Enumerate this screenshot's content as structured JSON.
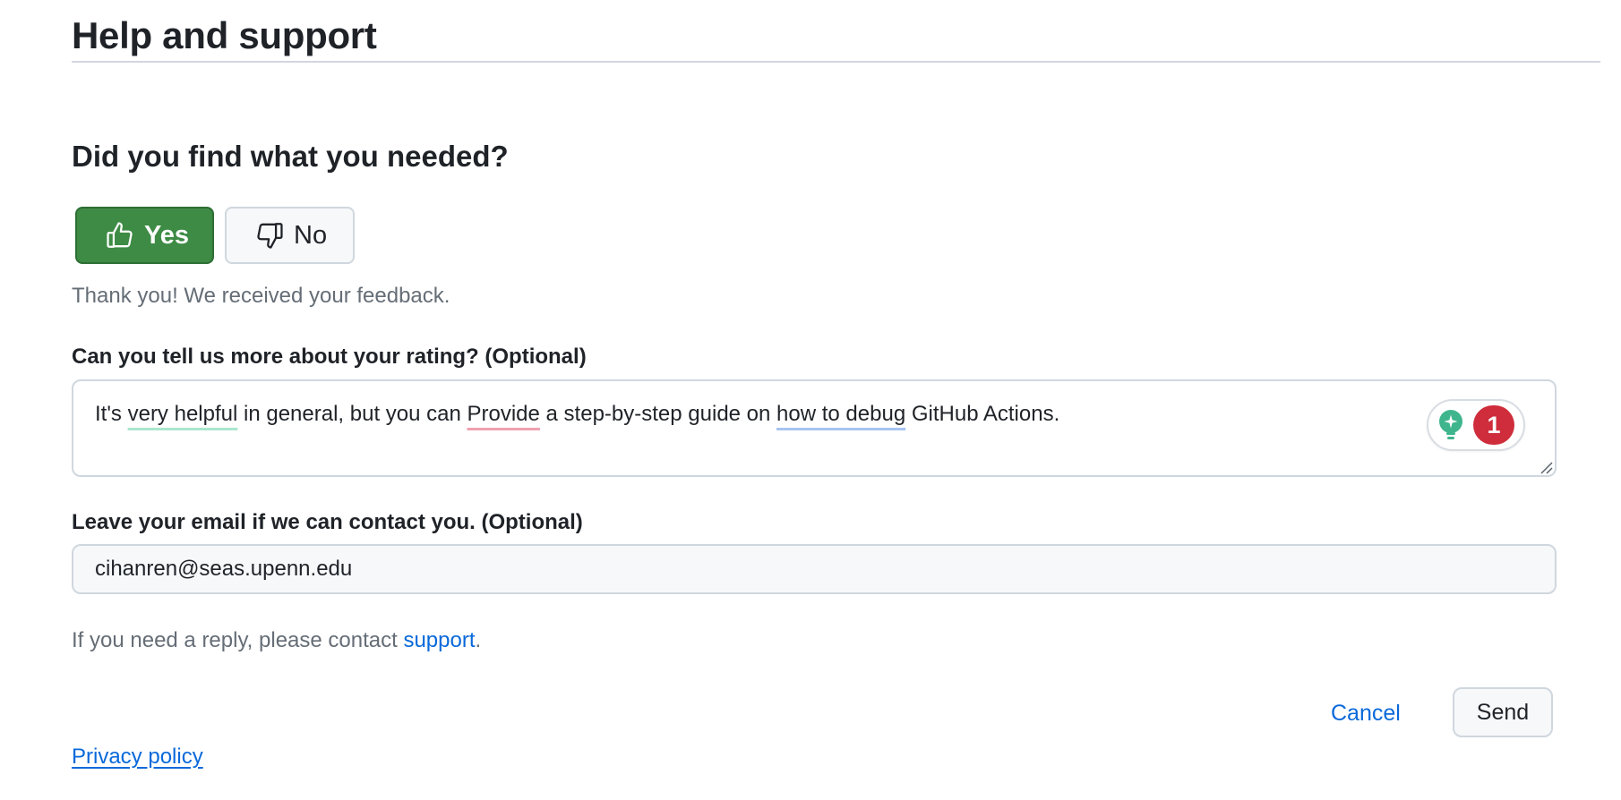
{
  "page": {
    "title": "Help and support"
  },
  "feedback": {
    "question": "Did you find what you needed?",
    "yes_label": "Yes",
    "no_label": "No",
    "selected": "Yes",
    "thanks_message": "Thank you! We received your feedback."
  },
  "rating_details": {
    "label": "Can you tell us more about your rating? (Optional)",
    "text_segments": [
      "It's ",
      "very helpful",
      " in general, but you can ",
      "Provide",
      " a step-by-step guide on ",
      "how to debug",
      " GitHub Actions."
    ],
    "grammar_widget": {
      "icon": "lightbulb-icon",
      "issue_count": "1"
    }
  },
  "email": {
    "label": "Leave your email if we can contact you. (Optional)",
    "value": "cihanren@seas.upenn.edu"
  },
  "reply_note": {
    "prefix": "If you need a reply, please contact ",
    "link_text": "support",
    "suffix": "."
  },
  "actions": {
    "cancel_label": "Cancel",
    "send_label": "Send"
  },
  "footer": {
    "privacy_label": "Privacy policy"
  },
  "colors": {
    "yes_button": "#3d8b44",
    "link": "#0969da",
    "badge": "#cf2d3b",
    "muted_text": "#656d76"
  }
}
